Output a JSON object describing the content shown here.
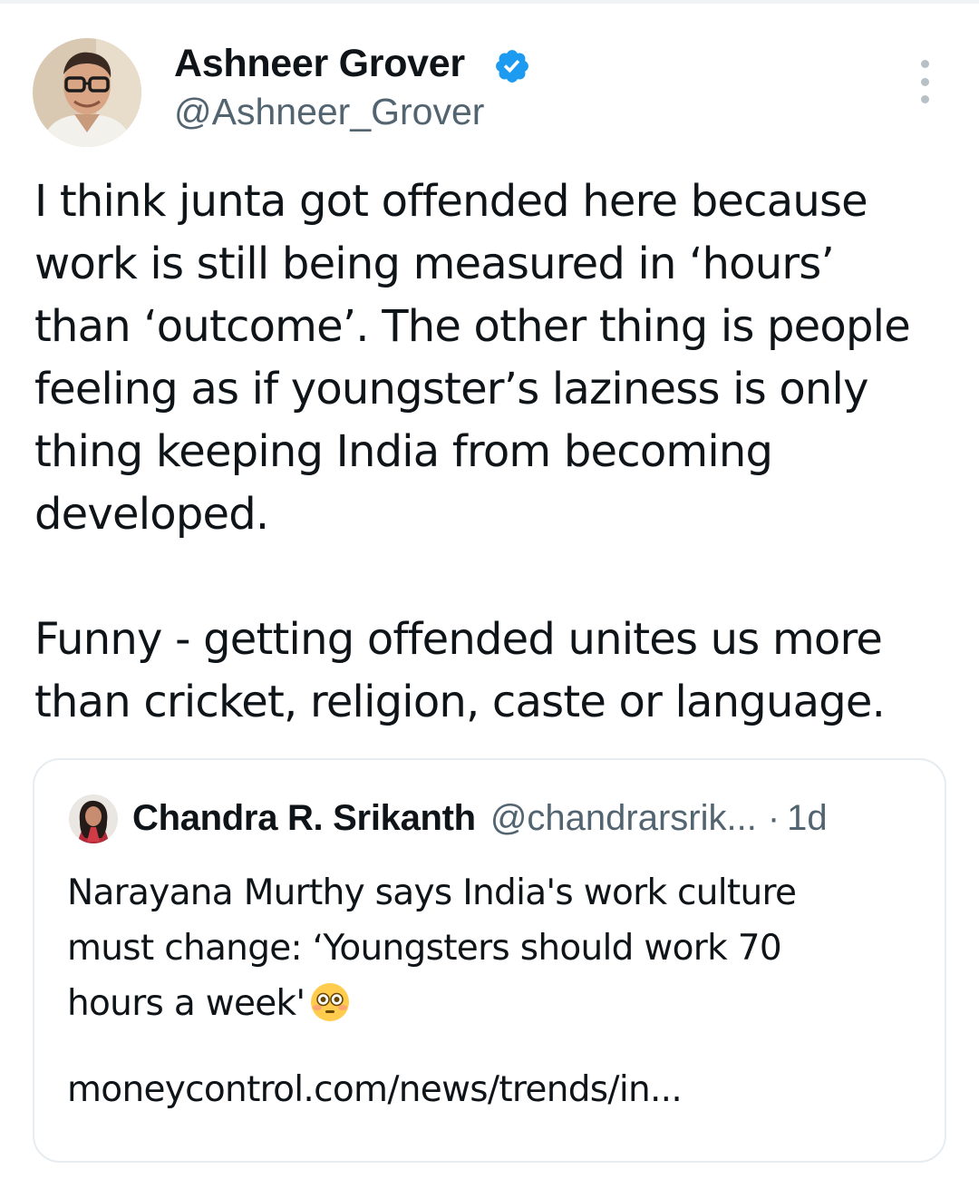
{
  "tweet": {
    "author": {
      "name": "Ashneer Grover",
      "handle": "@Ashneer_Grover",
      "verified": true,
      "avatar_icon": "person-with-glasses-avatar"
    },
    "text_paragraphs": [
      "I think junta got offended here because\nwork is still being measured in ‘hours’\nthan ‘outcome’. The other thing is people\nfeeling as if youngster’s laziness is only\nthing keeping India from becoming\ndeveloped.",
      "Funny - getting offended unites us more\nthan cricket, religion, caste or language."
    ]
  },
  "quoted_tweet": {
    "author": {
      "name": "Chandra R. Srikanth",
      "handle": "@chandrarsrik...",
      "avatar_icon": "person-avatar"
    },
    "separator": "·",
    "time": "1d",
    "text": "Narayana Murthy says India's work culture\nmust change: ‘Youngsters should work 70\nhours a week'",
    "emoji": "flushed-face-emoji",
    "link": "moneycontrol.com/news/trends/in..."
  },
  "colors": {
    "text_primary": "#0f1419",
    "text_secondary": "#536471",
    "verified_blue": "#1d9bf0",
    "card_border": "#e6ecf0"
  }
}
